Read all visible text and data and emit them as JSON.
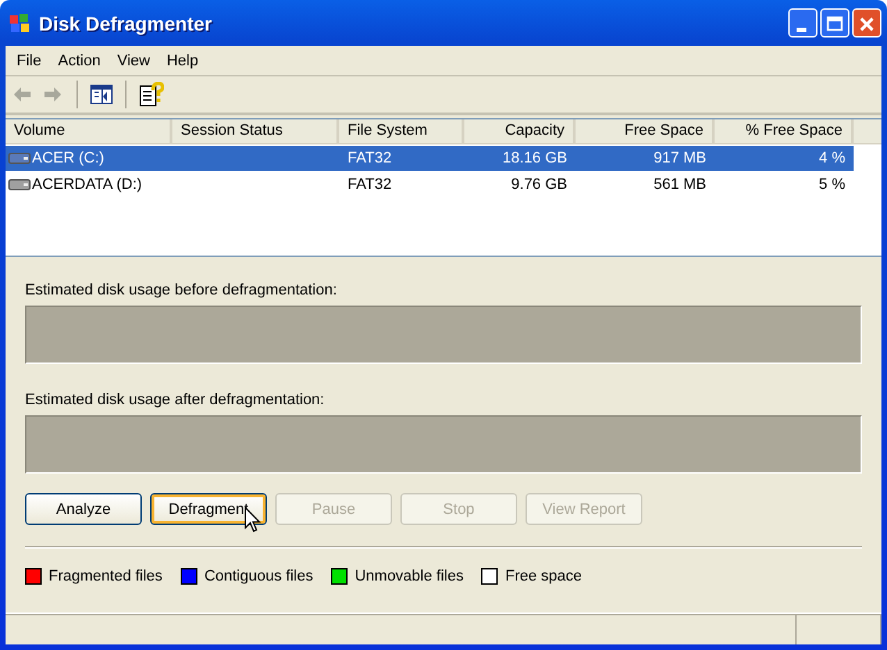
{
  "window": {
    "title": "Disk Defragmenter"
  },
  "menu": [
    "File",
    "Action",
    "View",
    "Help"
  ],
  "table": {
    "columns": [
      {
        "label": "Volume",
        "kind": "text"
      },
      {
        "label": "Session Status",
        "kind": "text"
      },
      {
        "label": "File System",
        "kind": "text"
      },
      {
        "label": "Capacity",
        "kind": "number"
      },
      {
        "label": "Free Space",
        "kind": "number"
      },
      {
        "label": "% Free Space",
        "kind": "number"
      }
    ],
    "rows": [
      {
        "selected": true,
        "cells": [
          "ACER (C:)",
          "",
          "FAT32",
          "18.16 GB",
          "917 MB",
          "4 %"
        ]
      },
      {
        "selected": false,
        "cells": [
          "ACERDATA (D:)",
          "",
          "FAT32",
          "9.76 GB",
          "561 MB",
          "5 %"
        ]
      }
    ]
  },
  "usage": [
    {
      "label": "Estimated disk usage before defragmentation:"
    },
    {
      "label": "Estimated disk usage after defragmentation:"
    }
  ],
  "buttons": [
    {
      "label": "Analyze",
      "disabled": false,
      "hovered": false
    },
    {
      "label": "Defragment",
      "disabled": false,
      "hovered": true
    },
    {
      "label": "Pause",
      "disabled": true,
      "hovered": false
    },
    {
      "label": "Stop",
      "disabled": true,
      "hovered": false
    },
    {
      "label": "View Report",
      "disabled": true,
      "hovered": false
    }
  ],
  "legend": [
    {
      "label": "Fragmented files",
      "color": "#ff0000"
    },
    {
      "label": "Contiguous files",
      "color": "#0000ff"
    },
    {
      "label": "Unmovable files",
      "color": "#00e000"
    },
    {
      "label": "Free space",
      "color": "#ffffff"
    }
  ]
}
